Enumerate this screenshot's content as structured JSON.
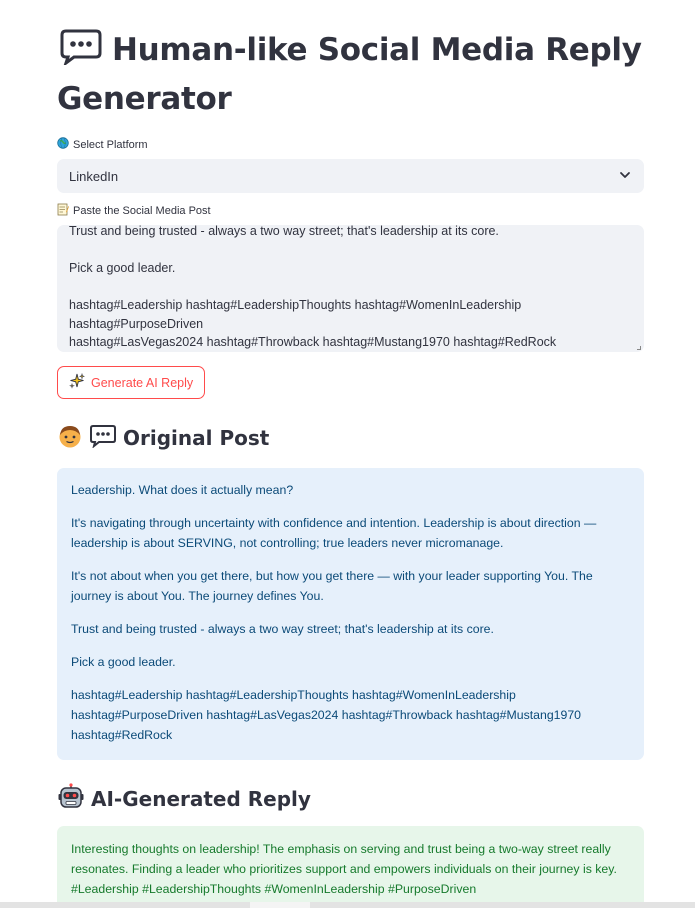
{
  "header": {
    "title": "Human-like Social Media Reply Generator",
    "title_icon": "speech-bubble-icon"
  },
  "platform": {
    "label": "Select Platform",
    "label_icon": "globe-icon",
    "selected": "LinkedIn"
  },
  "post_input": {
    "label": "Paste the Social Media Post",
    "label_icon": "memo-icon",
    "visible_lines": [
      "Trust and being trusted - always a two way street; that's leadership at its core.",
      "",
      "Pick a good leader.",
      "",
      "hashtag#Leadership hashtag#LeadershipThoughts hashtag#WomenInLeadership",
      "hashtag#PurposeDriven",
      "hashtag#LasVegas2024 hashtag#Throwback hashtag#Mustang1970 hashtag#RedRock"
    ]
  },
  "generate_button": {
    "label": "Generate AI Reply",
    "icon": "sparkles-icon"
  },
  "original_section": {
    "heading": "Original Post",
    "icons": [
      "person-icon",
      "speech-bubble-icon"
    ],
    "paragraphs": [
      "Leadership. What does it actually mean?",
      "It's navigating through uncertainty with confidence and intention. Leadership is about direction — leadership is about SERVING, not controlling; true leaders never micromanage.",
      "It's not about when you get there, but how you get there — with your leader supporting You. The journey is about You. The journey defines You.",
      "Trust and being trusted - always a two way street; that's leadership at its core.",
      "Pick a good leader.",
      "hashtag#Leadership hashtag#LeadershipThoughts hashtag#WomenInLeadership hashtag#PurposeDriven hashtag#LasVegas2024 hashtag#Throwback hashtag#Mustang1970 hashtag#RedRock"
    ]
  },
  "ai_section": {
    "heading": "AI-Generated Reply",
    "icon": "robot-icon",
    "reply": "Interesting thoughts on leadership! The emphasis on serving and trust being a two-way street really resonates. Finding a leader who prioritizes support and empowers individuals on their journey is key. #Leadership #LeadershipThoughts #WomenInLeadership #PurposeDriven"
  },
  "colors": {
    "accent": "#ff4b4b",
    "info_bg": "#e6f0fb",
    "info_text": "#0b4a78",
    "success_bg": "#e7f6ea",
    "success_text": "#167a2c",
    "input_bg": "#f0f2f6"
  }
}
